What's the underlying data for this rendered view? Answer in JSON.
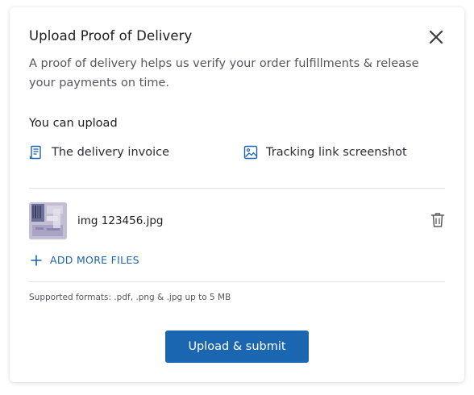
{
  "modal": {
    "title": "Upload Proof of Delivery",
    "description": "A proof of delivery helps us verify your order fulfillments & release your payments on time.",
    "close_icon": "close-icon"
  },
  "upload_options": {
    "heading": "You can upload",
    "items": [
      {
        "label": "The delivery invoice",
        "icon": "invoice-icon"
      },
      {
        "label": "Tracking link screenshot",
        "icon": "image-icon"
      }
    ]
  },
  "files": [
    {
      "name": "img 123456.jpg",
      "thumbnail_icon": "image-thumbnail",
      "delete_icon": "trash-icon"
    }
  ],
  "add_more_label": "ADD MORE FILES",
  "supported_formats": "Supported formats: .pdf, .png & .jpg up to 5 MB",
  "submit_label": "Upload & submit",
  "colors": {
    "primary": "#1b66b1",
    "link": "#1a64ad",
    "text": "#1d1d22",
    "muted": "#55575d",
    "divider": "#e2e3e6"
  }
}
